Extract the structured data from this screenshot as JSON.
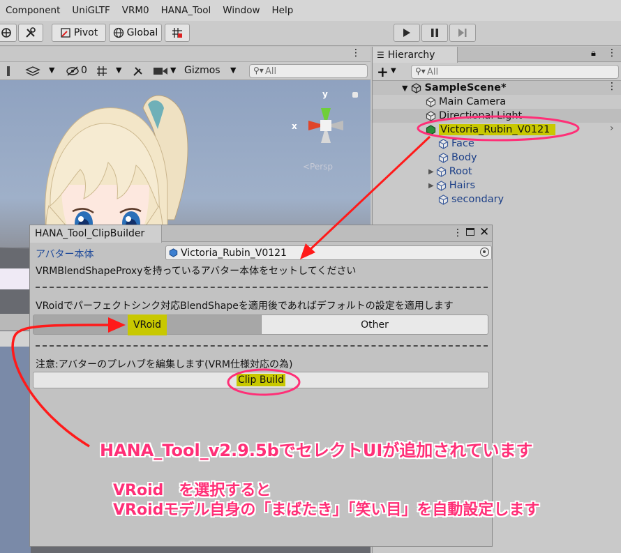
{
  "menu": [
    "Component",
    "UniGLTF",
    "VRM0",
    "HANA_Tool",
    "Window",
    "Help"
  ],
  "toolbar": {
    "pivot_label": "Pivot",
    "global_label": "Global"
  },
  "scene": {
    "hidden_count": "0",
    "gizmos_label": "Gizmos",
    "search_placeholder": "All",
    "gizmo_x": "x",
    "gizmo_y": "y",
    "persp_label": "<Persp"
  },
  "hierarchy": {
    "tab_label": "Hierarchy",
    "search_placeholder": "All",
    "items": [
      {
        "label": "SampleScene*",
        "depth": 0
      },
      {
        "label": "Main Camera",
        "depth": 1
      },
      {
        "label": "Directional Light",
        "depth": 1
      },
      {
        "label": "Victoria_Rubin_V0121",
        "depth": 1
      },
      {
        "label": "Face",
        "depth": 2
      },
      {
        "label": "Body",
        "depth": 2
      },
      {
        "label": "Root",
        "depth": 2
      },
      {
        "label": "Hairs",
        "depth": 2
      },
      {
        "label": "secondary",
        "depth": 2
      }
    ]
  },
  "clip": {
    "title": "HANA_Tool_ClipBuilder",
    "avatar_label": "アバター本体",
    "avatar_value": "Victoria_Rubin_V0121",
    "instruction": "VRMBlendShapeProxyを持っているアバター本体をセットしてください",
    "vroid_note": "VRoidでパーフェクトシンク対応BlendShapeを適用後であればデフォルトの設定を適用します",
    "option_vroid": "VRoid",
    "option_other": "Other",
    "warning": "注意:アバターのプレハブを編集します(VRM仕様対応の為)",
    "build_button": "Clip Build"
  },
  "annotations": {
    "line1": "HANA_Tool_v2.9.5bでセレクトUIが追加されています",
    "line2": "VRoid　を選択すると",
    "line3": "VRoidモデル自身の「まばたき」「笑い目」を自動設定します"
  },
  "colors": {
    "highlight": "#c8c800",
    "annotation": "#ff2f77",
    "link_blue": "#1c3f87"
  }
}
